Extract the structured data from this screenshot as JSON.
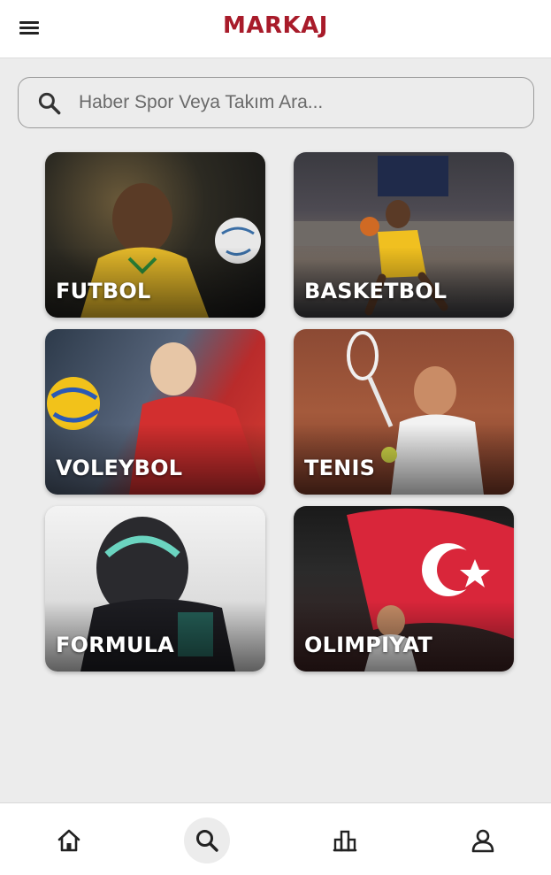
{
  "header": {
    "logo": "MARKAJ",
    "menu_icon": "menu-icon"
  },
  "search": {
    "placeholder": "Haber Spor Veya Takım Ara...",
    "icon": "search-icon"
  },
  "categories": [
    {
      "label": "FUTBOL"
    },
    {
      "label": "BASKETBOL"
    },
    {
      "label": "VOLEYBOL"
    },
    {
      "label": "TENIS"
    },
    {
      "label": "FORMULA"
    },
    {
      "label": "OLIMPIYAT"
    }
  ],
  "bottom_nav": {
    "items": [
      {
        "icon": "home-icon"
      },
      {
        "icon": "search-icon",
        "active": true
      },
      {
        "icon": "stats-icon"
      },
      {
        "icon": "profile-icon"
      }
    ]
  },
  "colors": {
    "brand": "#a81b2a",
    "background": "#ececec",
    "bar": "#ffffff"
  }
}
